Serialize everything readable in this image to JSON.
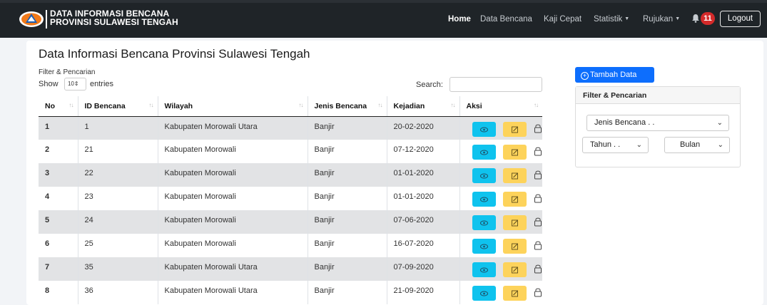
{
  "nav": {
    "brand_line1": "DATA INFORMASI BENCANA",
    "brand_line2": "PROVINSI SULAWESI TENGAH",
    "links": [
      "Home",
      "Data Bencana",
      "Kaji Cepat",
      "Statistik",
      "Rujukan"
    ],
    "notification_count": "11",
    "logout": "Logout"
  },
  "main": {
    "title": "Data Informasi Bencana Provinsi Sulawesi Tengah",
    "filter_label": "Filter & Pencarian",
    "show_label": "Show",
    "show_value": "10",
    "entries_label": "entries",
    "search_label": "Search:",
    "columns": [
      "No",
      "ID Bencana",
      "Wilayah",
      "Jenis Bencana",
      "Kejadian",
      "Aksi"
    ],
    "rows": [
      {
        "no": "1",
        "id": "1",
        "wilayah": "Kabupaten Morowali Utara",
        "jenis": "Banjir",
        "kejadian": "20-02-2020"
      },
      {
        "no": "2",
        "id": "21",
        "wilayah": "Kabupaten Morowali",
        "jenis": "Banjir",
        "kejadian": "07-12-2020"
      },
      {
        "no": "3",
        "id": "22",
        "wilayah": "Kabupaten Morowali",
        "jenis": "Banjir",
        "kejadian": "01-01-2020"
      },
      {
        "no": "4",
        "id": "23",
        "wilayah": "Kabupaten Morowali",
        "jenis": "Banjir",
        "kejadian": "01-01-2020"
      },
      {
        "no": "5",
        "id": "24",
        "wilayah": "Kabupaten Morowali",
        "jenis": "Banjir",
        "kejadian": "07-06-2020"
      },
      {
        "no": "6",
        "id": "25",
        "wilayah": "Kabupaten Morowali",
        "jenis": "Banjir",
        "kejadian": "16-07-2020"
      },
      {
        "no": "7",
        "id": "35",
        "wilayah": "Kabupaten Morowali Utara",
        "jenis": "Banjir",
        "kejadian": "07-09-2020"
      },
      {
        "no": "8",
        "id": "36",
        "wilayah": "Kabupaten Morowali Utara",
        "jenis": "Banjir",
        "kejadian": "21-09-2020"
      }
    ]
  },
  "sidebar": {
    "tambah_label": "Tambah Data",
    "card_title": "Filter & Pencarian",
    "jenis_select": "Jenis Bencana . .",
    "tahun_select": "Tahun . .",
    "bulan_select": "Bulan"
  },
  "icons": {
    "logo": "bnpb-logo",
    "bell": "bell-icon",
    "view": "eye-icon",
    "edit": "edit-icon",
    "lock": "lock-icon",
    "add": "plus-circle-icon"
  },
  "colors": {
    "navbar": "#1f2428",
    "badge": "#d42a2a",
    "primary": "#0d6efd",
    "view_button": "#0fc3ee",
    "edit_button": "#fdd35b",
    "odd_row": "#e2e3e5"
  }
}
